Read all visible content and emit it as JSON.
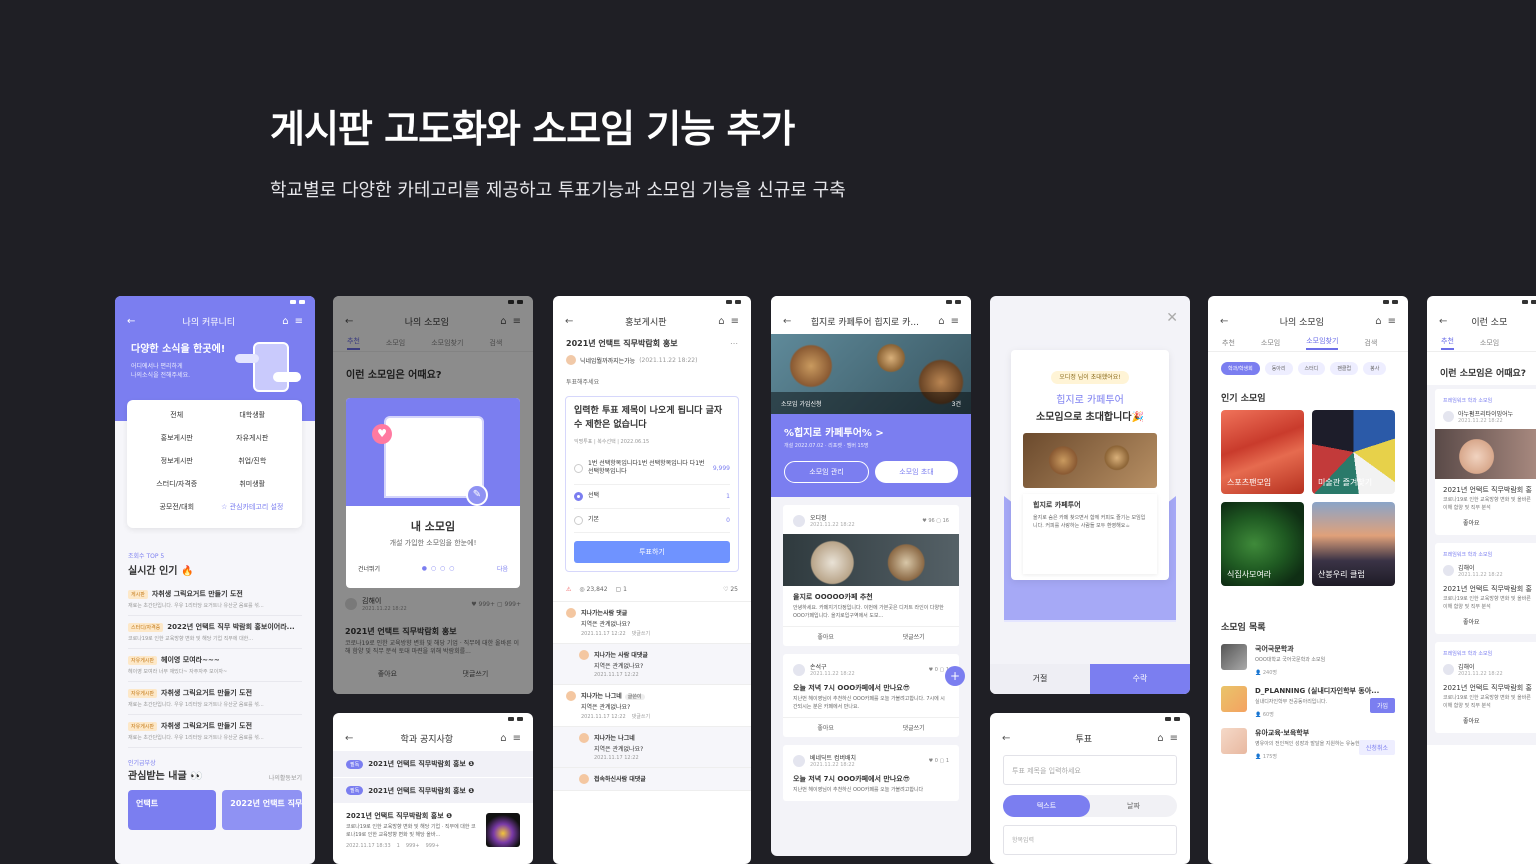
{
  "hero": {
    "title": "게시판 고도화와 소모임 기능 추가",
    "subtitle": "학교별로 다양한 카테고리를 제공하고 투표기능과 소모임 기능을 신규로 구축"
  },
  "p1": {
    "title": "나의 커뮤니티",
    "banner_title": "다양한 소식을 한곳에!",
    "banner_desc1": "어디에서나 편리하게",
    "banner_desc2": "나의소식을 전해주세요.",
    "menu": [
      "전체",
      "대학생활",
      "홍보게시판",
      "자유게시판",
      "정보게시판",
      "취업/진학",
      "스터디/자격증",
      "취미생활",
      "공모전/대회"
    ],
    "menu_setting": "☆ 관심카테고리 설정",
    "rank_label": "조회수 TOP 5",
    "rank_title": "실시간 인기 🔥",
    "posts": [
      {
        "tag": "게시판",
        "title": "자취생 그릭요거트 만들기 도전",
        "desc": "재료는 초간단입니다. 우유 1리터당 요거트나 유산균 음료를 섞..."
      },
      {
        "tag": "스터디/자격증",
        "title": "2022년 언택트 직무 박람회 홍보이어라...",
        "desc": "코로나19로 인한 교육방향 변화 및 해당 기업 직무에 대한..."
      },
      {
        "tag": "자유게시판",
        "title": "헤이영 모여라~~~",
        "desc": "헤이영 모여라 너무 재밌다~ 자주자주 모이자~"
      },
      {
        "tag": "자유게시판",
        "title": "자취생 그릭요거트 만들기 도전",
        "desc": "재료는 초간단입니다. 우유 1리터당 요거트나 유산균 음료를 섞..."
      },
      {
        "tag": "자유게시판",
        "title": "자취생 그릭요거트 만들기 도전",
        "desc": "재료는 초간단입니다. 우유 1리터당 요거트나 유산균 음료를 섞..."
      }
    ],
    "interest_label": "인기급부상",
    "interest_title": "관심받는 내글 👀",
    "interest_more": "나의활동보기",
    "cards": [
      "언택트",
      "2022년 언택트 직무박람회 홍"
    ]
  },
  "p2": {
    "title": "나의 소모임",
    "tabs": [
      "추천",
      "소모임",
      "소모임찾기",
      "검색"
    ],
    "heading": "이런 소모임은 어때요?",
    "modal_title": "내 소모임",
    "modal_desc": "개설 가입한 소모임을 한눈에!",
    "skip": "건너뛰기",
    "next": "다음",
    "author": "김해이",
    "date": "2021.11.22 18:22",
    "post_title": "2021년 언택트 직무박람회 홍보",
    "post_desc": "코로나19로 인한 교육방향 변화 및 해당 기업 · 직무에 대한 올바른 이해 함양 및 직무 분석 토대 마련을 위해 박람회를...",
    "like": "좋아요",
    "comment": "댓글쓰기",
    "l999": "999+"
  },
  "p3": {
    "title": "학과 공지사항",
    "rows": [
      "2021년 언택트 직무박람회 홍보 ❶",
      "2021년 언택트 직무박람회 홍보 ❶"
    ],
    "badge": "필독",
    "post_title": "2021년 언택트 직무박람회 홍보 ❶",
    "post_desc": "코로나19로 인한 교육방향 변화 및 해당 기업 · 직무에 대한 코로나19로 인한 교육방향 변화 및 해당 올바...",
    "date": "2022.11.17 18:33",
    "c1": "1",
    "c2": "999+",
    "c3": "999+"
  },
  "p4": {
    "title": "홍보게시판",
    "post_title": "2021년 언택트 직무박람회 홍보",
    "author": "닉네임뭘까까지는가능",
    "author_date": "(2021.11.22 18:22)",
    "vote_label": "투표해주세요",
    "vote_q": "입력한 투표 제목이 나오게 됩니다 글자 수 제한은 없습니다",
    "vote_meta": "익명투표  |  복수선택  |  2022.06.15",
    "options": [
      {
        "label": "1번 선택항목입니다1번 선택항목입니다 다1번 선택항목입니다",
        "count": "9,999"
      },
      {
        "label": "선택",
        "count": "1"
      },
      {
        "label": "기본",
        "count": "0"
      }
    ],
    "vote_btn": "투표하기",
    "views": "23,842",
    "cmts": "1",
    "likes": "25",
    "comments": [
      {
        "name": "지나가는사람 댓글",
        "text": "지역은 관계없나요?",
        "date": "2021.11.17 12:22",
        "reply": "댓글쓰기"
      },
      {
        "name": "지나가는 사람 대댓글",
        "text": "지역은 관계없나요?",
        "date": "2021.11.17 12:22"
      },
      {
        "name": "지나가는 나그네",
        "badge": "글쓴이",
        "text": "지역은 관계없나요?",
        "date": "2021.11.17 12:22",
        "reply": "댓글쓰기"
      },
      {
        "name": "지나가는 나그네",
        "text": "지역은 관계없나요?",
        "date": "2021.11.17 12:22"
      },
      {
        "name": "접속하신사람 대댓글",
        "text": ""
      }
    ]
  },
  "p5": {
    "title": "힙지로 카페투어 힙지로 카...",
    "join": "소모임 가입신청",
    "count": "3건",
    "group_name": "%힙지로 카페투어% >",
    "group_meta": "개설 2022.07.02 · 리포켓 · 멤버 15명",
    "manage_btn": "소모임 관리",
    "invite_btn": "소모임 초대",
    "posts": [
      {
        "name": "오디정",
        "date": "2021.11.22 18:22",
        "likes": "96",
        "cmts": "16",
        "title": "을지로 OOOOO카페 추천",
        "desc": "안녕하세요. 카페지기다정입니다. 이번에 가본곳은 디저트 라인이 다양한 OOO가페입니다. 을지로입구역에서 도보..."
      },
      {
        "name": "손석구",
        "date": "2021.11.22 18:22",
        "likes": "0",
        "cmts": "1",
        "title": "오늘 저녁 7시 OOO카페에서 만나요😎",
        "desc": "지난번 헤이영님이 추천하신 OOO카페를 오늘 가볼려고합니다. 7시에 시간되시는 분은 카페에서 만나요."
      },
      {
        "name": "베네딕트 컴버배치",
        "date": "2021.11.22 18:22",
        "likes": "0",
        "cmts": "1",
        "title": "오늘 저녁 7시 OOO카페에서 만나요😎",
        "desc": "지난번 헤이영님이 추천하신 OOO카페를 오늘 가볼려고합니다"
      }
    ],
    "like": "좋아요",
    "comment": "댓글쓰기"
  },
  "p6": {
    "invite_from": "오디정 님이 초대했어요!",
    "invite_name": "힙지로 카페투어",
    "invite_msg": "소모임으로 초대합니다🎉",
    "card_title": "힙지로 카페투어",
    "card_desc": "을지로 숨은 카페 찾으면서 함께 커피도 즐기는 모임입니다. 커피를 사랑하는 사람들 모두 환영해요☕",
    "reject": "거절",
    "accept": "수락"
  },
  "p7": {
    "title": "투표",
    "placeholder": "투표 제목을 입력하세요",
    "type_text": "텍스트",
    "type_date": "날짜",
    "item_placeholder": "항목입력"
  },
  "p8": {
    "title": "나의 소모임",
    "tabs": [
      "추천",
      "소모임",
      "소모임찾기",
      "검색"
    ],
    "chips": [
      "학과/학생회",
      "동아리",
      "스터디",
      "팬클럽",
      "봉사"
    ],
    "popular": "인기 소모임",
    "groups": [
      "스포츠팬모임",
      "미술관 즐겨찾기",
      "식집사모여라",
      "산봉우리 클럽"
    ],
    "list_title": "소모임 목록",
    "list": [
      {
        "name": "국어국문학과",
        "desc": "OOO대학교 국어국문학과 소모임",
        "count": "240명",
        "btn": ""
      },
      {
        "name": "D_PLANNING (실내디자인학부 동아...",
        "desc": "실내디자인학부 전공동아리입니다.",
        "count": "60명",
        "btn": "가입"
      },
      {
        "name": "유아교육·보육학부",
        "desc": "영유아의 전인적인 성장과 발달을 지원하는 유능한...",
        "count": "175명",
        "btn": "신청취소"
      }
    ]
  },
  "p9": {
    "title": "이런 소모",
    "tabs": [
      "추천",
      "소모임"
    ],
    "heading": "이런 소모임은 어때요?",
    "items": [
      {
        "tag": "프레임워크 학과 소모임",
        "name": "아누펌프리타이밍어누",
        "date": "2021.11.22 18:22",
        "title": "2021년 언택트 직무박람회 홍",
        "desc": "코로나19로 인한 교육방향 변화 및 올바른 이해 함양 및 직무 분석"
      },
      {
        "tag": "프레임워크 학과 소모임",
        "name": "김해이",
        "date": "2021.11.22 18:22",
        "title": "2021년 언택트 직무박람회 홍",
        "desc": "코로나19로 인한 교육방향 변화 및 올바른 이해 함양 및 직무 분석"
      },
      {
        "tag": "프레임워크 학과 소모임",
        "name": "김해이",
        "date": "2021.11.22 18:22",
        "title": "2021년 언택트 직무박람회 홍",
        "desc": "코로나19로 인한 교육방향 변화 및 올바른 이해 함양 및 직무 분석"
      }
    ],
    "like": "좋아요"
  },
  "colors": {
    "accent": "#7b7ef0",
    "bg": "#1f1f25"
  }
}
